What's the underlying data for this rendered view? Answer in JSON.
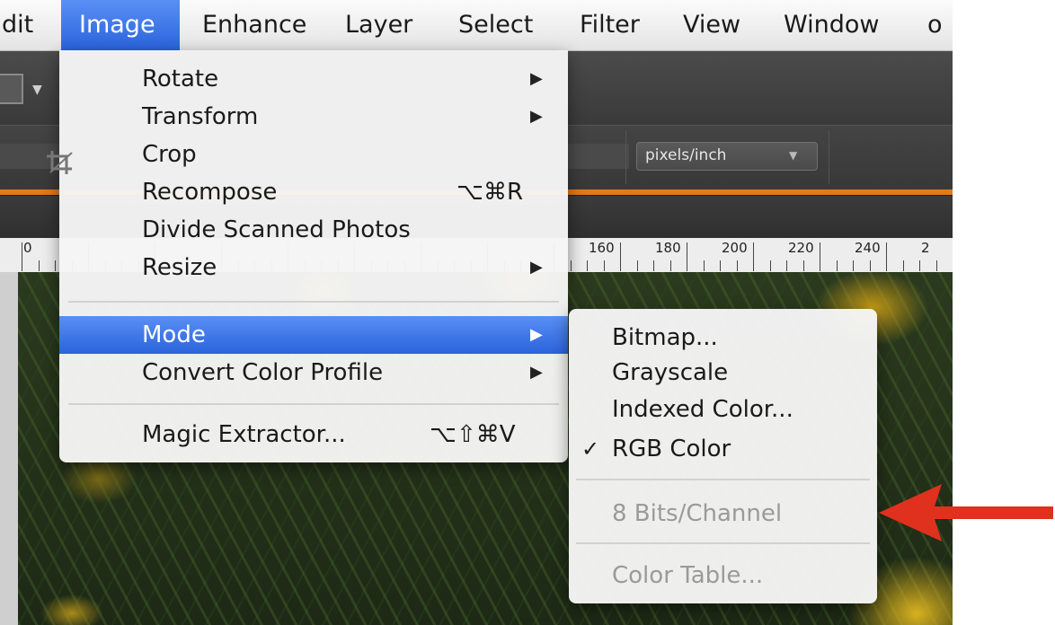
{
  "menubar": {
    "items": [
      {
        "label": "dit",
        "active": false
      },
      {
        "label": "Image",
        "active": true
      },
      {
        "label": "Enhance",
        "active": false
      },
      {
        "label": "Layer",
        "active": false
      },
      {
        "label": "Select",
        "active": false
      },
      {
        "label": "Filter",
        "active": false
      },
      {
        "label": "View",
        "active": false
      },
      {
        "label": "Window",
        "active": false
      },
      {
        "label": "o",
        "active": false
      }
    ]
  },
  "toolbar": {
    "resolution_units": "pixels/inch",
    "dropdown_icon": "chevron-down-icon"
  },
  "ruler": {
    "labels": [
      "0",
      "160",
      "180",
      "200",
      "220",
      "240",
      "2"
    ]
  },
  "image_menu": {
    "items": [
      {
        "label": "Rotate",
        "submenu": true
      },
      {
        "label": "Transform",
        "submenu": true
      },
      {
        "label": "Crop",
        "icon": "crop-icon"
      },
      {
        "label": "Recompose",
        "shortcut": "⌥⌘R"
      },
      {
        "label": "Divide Scanned Photos"
      },
      {
        "label": "Resize",
        "submenu": true
      },
      {
        "label": "Mode",
        "submenu": true,
        "highlighted": true
      },
      {
        "label": "Convert Color Profile",
        "submenu": true
      },
      {
        "label": "Magic Extractor...",
        "shortcut": "⌥⇧⌘V"
      }
    ],
    "submenu_arrow": "▶"
  },
  "mode_submenu": {
    "items": [
      {
        "label": "Bitmap...",
        "checked": false,
        "enabled": true
      },
      {
        "label": "Grayscale",
        "checked": false,
        "enabled": true
      },
      {
        "label": "Indexed Color...",
        "checked": false,
        "enabled": true
      },
      {
        "label": "RGB Color",
        "checked": true,
        "enabled": true
      },
      {
        "label": "8 Bits/Channel",
        "checked": false,
        "enabled": false
      },
      {
        "label": "Color Table...",
        "checked": false,
        "enabled": false
      }
    ],
    "check_mark": "✓"
  },
  "colors": {
    "menu_highlight": "#2a63dc",
    "orange_accent": "#e07a1a",
    "annotation_arrow": "#e0301e",
    "disabled_text": "#9a9a9a"
  }
}
